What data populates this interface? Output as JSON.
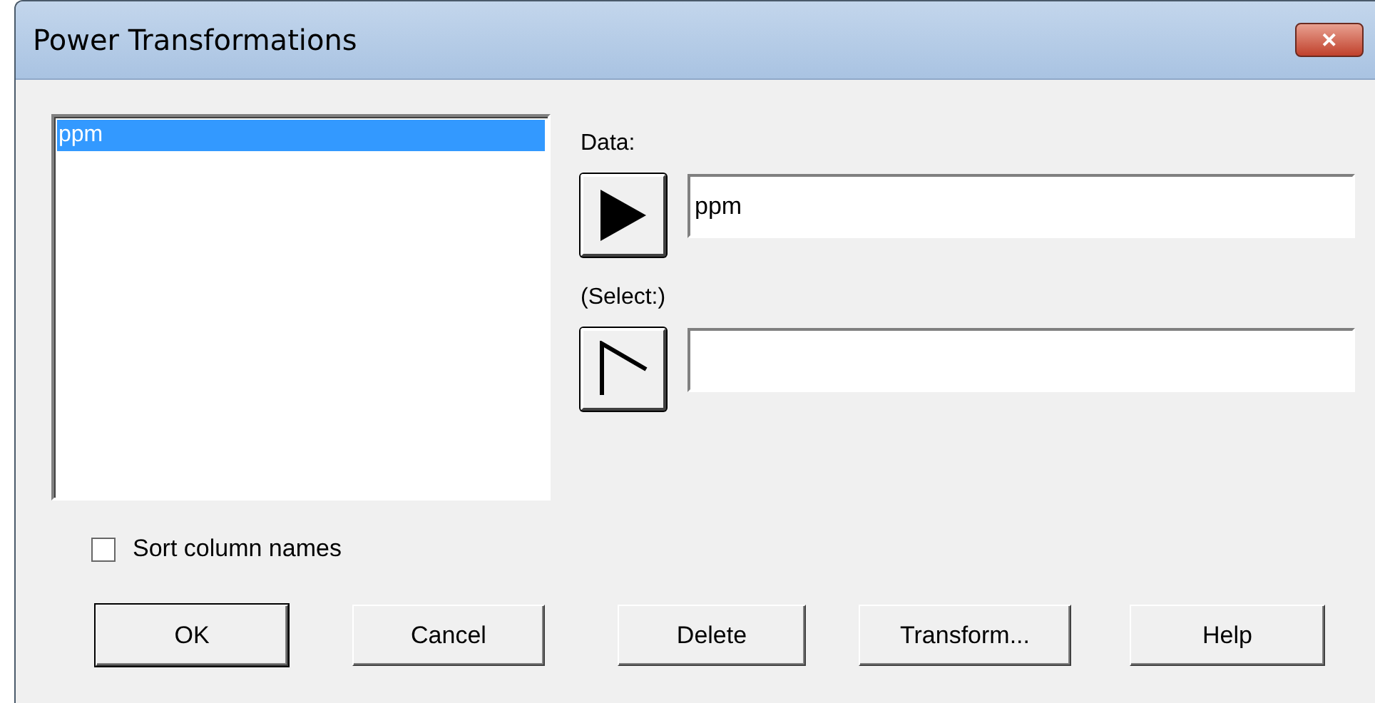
{
  "window": {
    "title": "Power Transformations",
    "close": "✕"
  },
  "columns_list": {
    "items": [
      {
        "label": "ppm",
        "selected": true
      }
    ]
  },
  "fields": [
    {
      "label": "Data:",
      "value": "ppm",
      "kind": "filled"
    },
    {
      "label": "(Select:)",
      "kind": "empty"
    }
  ],
  "sort_checkbox": {
    "label": "Sort column names",
    "checked": false
  },
  "buttons": [
    {
      "label": "OK",
      "default": true
    },
    {
      "label": "Cancel",
      "default": false
    },
    {
      "label": "Delete",
      "default": false
    },
    {
      "label": "Transform...",
      "default": false
    },
    {
      "label": "Help",
      "default": false
    }
  ]
}
